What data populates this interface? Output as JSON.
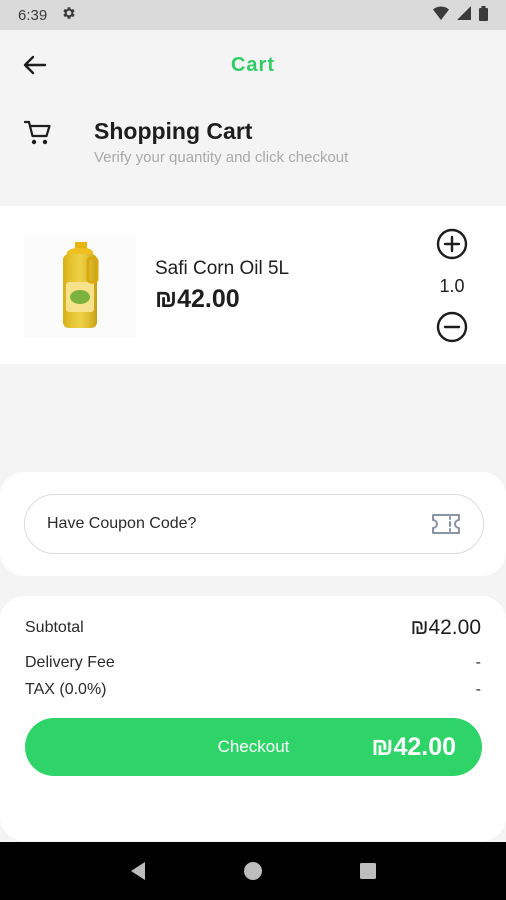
{
  "status_bar": {
    "time": "6:39",
    "icons": [
      "settings-icon",
      "wifi-icon",
      "signal-icon",
      "battery-icon"
    ]
  },
  "app_bar": {
    "title": "Cart",
    "back_icon": "arrow-left-icon",
    "accent_color": "#2ecc63"
  },
  "header": {
    "icon": "cart-icon",
    "title": "Shopping Cart",
    "subtitle": "Verify your quantity and click checkout"
  },
  "cart_items": [
    {
      "name": "Safi Corn Oil 5L",
      "price": "₪42.00",
      "quantity": "1.0",
      "image": "oil-bottle-image"
    }
  ],
  "coupon": {
    "label": "Have Coupon Code?",
    "icon": "ticket-icon"
  },
  "summary": {
    "subtotal_label": "Subtotal",
    "subtotal_value": "₪42.00",
    "delivery_label": "Delivery Fee",
    "delivery_value": "-",
    "tax_label": "TAX (0.0%)",
    "tax_value": "-"
  },
  "checkout": {
    "label": "Checkout",
    "total": "₪42.00",
    "color": "#2ed467"
  },
  "nav_bar": {
    "icons": [
      "back-triangle-icon",
      "home-circle-icon",
      "recents-square-icon"
    ]
  }
}
